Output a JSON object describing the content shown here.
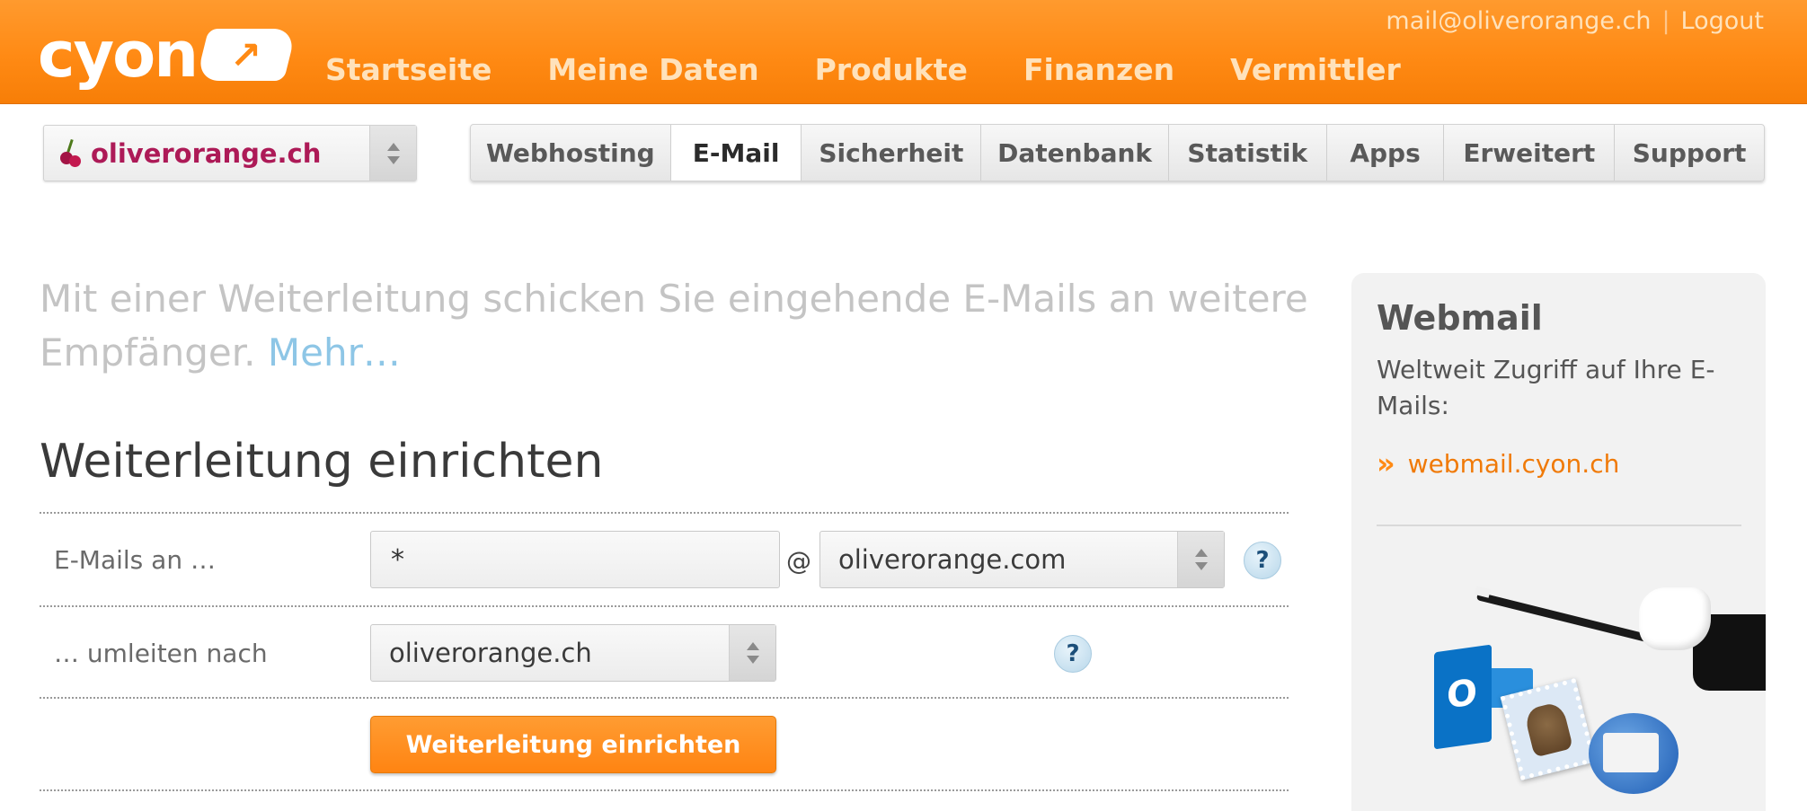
{
  "header": {
    "logo_text": "cyon",
    "logo_mark": "↗",
    "nav": [
      "Startseite",
      "Meine Daten",
      "Produkte",
      "Finanzen",
      "Vermittler"
    ],
    "user_email": "mail@oliverorange.ch",
    "separator": "|",
    "logout": "Logout"
  },
  "domain_select": {
    "value": "oliverorange.ch"
  },
  "tabs": [
    {
      "label": "Webhosting",
      "active": false
    },
    {
      "label": "E-Mail",
      "active": true
    },
    {
      "label": "Sicherheit",
      "active": false
    },
    {
      "label": "Datenbank",
      "active": false
    },
    {
      "label": "Statistik",
      "active": false
    },
    {
      "label": "Apps",
      "active": false
    },
    {
      "label": "Erweitert",
      "active": false
    },
    {
      "label": "Support",
      "active": false
    }
  ],
  "intro": {
    "text": "Mit einer Weiterleitung schicken Sie eingehende E-Mails an weitere Empfänger. ",
    "more_link": "Mehr…"
  },
  "form": {
    "title": "Weiterleitung einrichten",
    "row1_label": "E-Mails an …",
    "local_part_value": "*",
    "at_sign": "@",
    "domain_value": "oliverorange.com",
    "row2_label": "… umleiten nach",
    "target_value": "oliverorange.ch",
    "help": "?",
    "submit_label": "Weiterleitung einrichten"
  },
  "sidebar": {
    "title": "Webmail",
    "text": "Weltweit Zugriff auf Ihre E-Mails:",
    "arrows": "»",
    "link": "webmail.cyon.ch",
    "outlook_letter": "O"
  },
  "colors": {
    "brand_orange": "#ff8a14",
    "domain_magenta": "#ad1a57",
    "link_blue": "#8ec6e6"
  }
}
